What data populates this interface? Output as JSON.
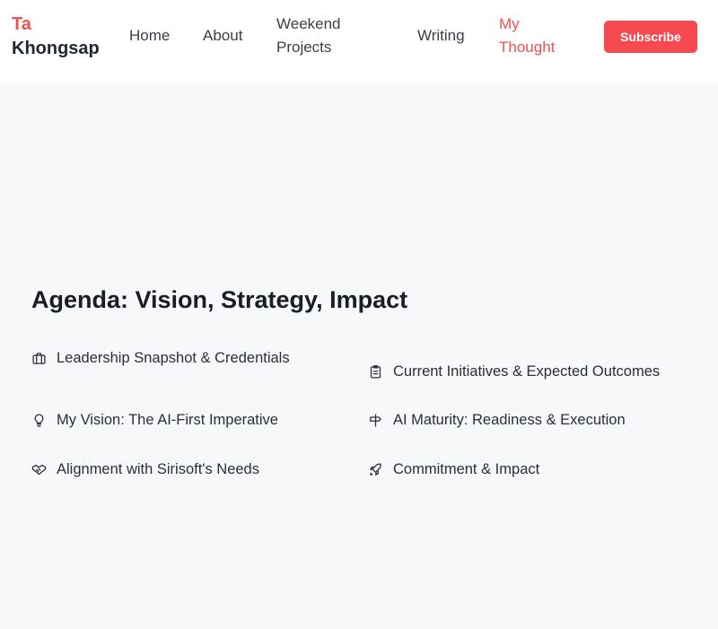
{
  "brand": {
    "first": "Ta",
    "last": "Khongsap"
  },
  "nav": {
    "home": "Home",
    "about": "About",
    "weekend": "Weekend Projects",
    "writing": "Writing",
    "thought": "My Thought"
  },
  "subscribe_label": "Subscribe",
  "agenda": {
    "title": "Agenda: Vision, Strategy, Impact",
    "items": [
      {
        "label": "Leadership Snapshot & Credentials",
        "icon": "briefcase-icon"
      },
      {
        "label": "Current Initiatives & Expected Outcomes",
        "icon": "clipboard-list-icon"
      },
      {
        "label": "My Vision: The AI-First Imperative",
        "icon": "lightbulb-icon"
      },
      {
        "label": "AI Maturity: Readiness & Execution",
        "icon": "signpost-icon"
      },
      {
        "label": "Alignment with Sirisoft's Needs",
        "icon": "handshake-icon"
      },
      {
        "label": "Commitment & Impact",
        "icon": "rocket-icon"
      }
    ]
  },
  "colors": {
    "accent": "#f0514f",
    "button": "#f74a4e",
    "background": "#f7f8fa",
    "header": "#ffffff"
  }
}
